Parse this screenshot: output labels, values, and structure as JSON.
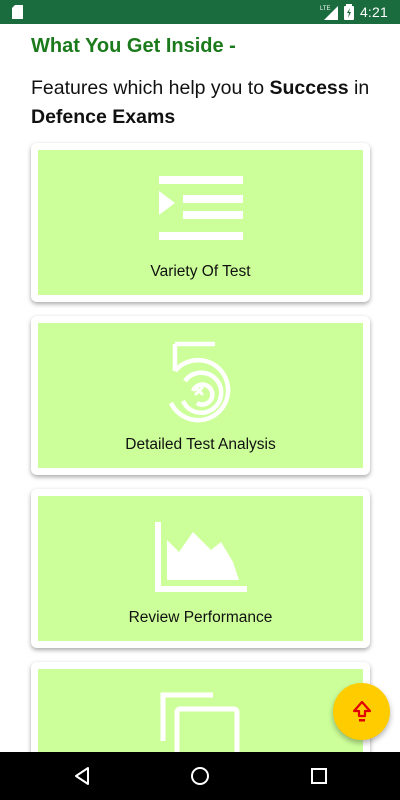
{
  "status_bar": {
    "network": "LTE",
    "time": "4:21"
  },
  "header": {
    "title": "What You Get Inside -",
    "subtitle_plain_1": "Features which help you to ",
    "subtitle_bold_1": "Success",
    "subtitle_plain_2": " in ",
    "subtitle_bold_2": "Defence Exams"
  },
  "cards": [
    {
      "label": "Variety Of Test",
      "icon": "list-play-icon"
    },
    {
      "label": "Detailed Test Analysis",
      "icon": "target-analysis-icon"
    },
    {
      "label": "Review Performance",
      "icon": "area-chart-icon"
    },
    {
      "label": "",
      "icon": "copy-pages-icon"
    }
  ],
  "fab": {
    "icon": "arrow-up-icon"
  },
  "colors": {
    "status_bar": "#1a6b3e",
    "heading": "#1b7a1b",
    "card_fill": "#ccff99",
    "fab": "#ffcc00",
    "fab_arrow": "#e00000"
  }
}
